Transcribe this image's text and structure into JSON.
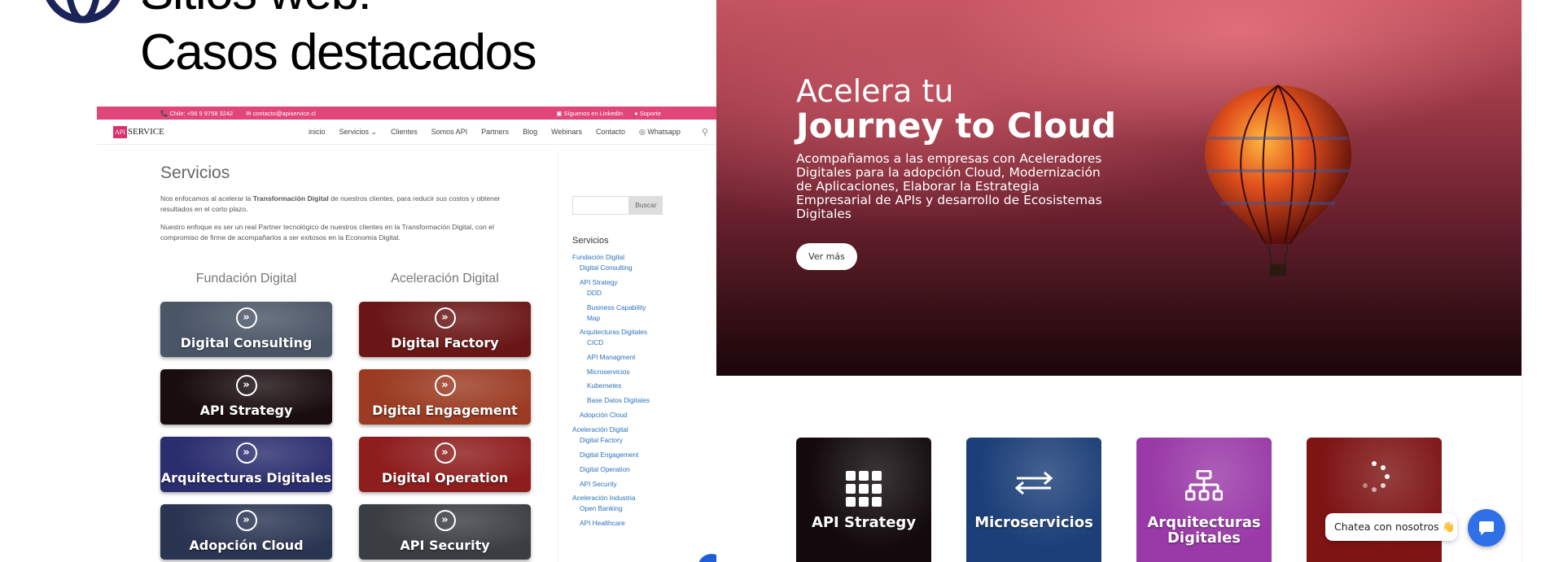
{
  "slide": {
    "title_line1": "Sitios web:",
    "title_line2": "Casos destacados"
  },
  "left_site": {
    "topbar": {
      "phone": "Chile: +56 9 9758 3242",
      "email": "contacto@apiservice.cl",
      "linkedin": "Síguenos en LinkedIn",
      "support": "Soporte"
    },
    "logo": {
      "part1": "API",
      "part2": "SERVICE"
    },
    "nav": [
      "inicio",
      "Servicios",
      "Clientes",
      "Somos API",
      "Partners",
      "Blog",
      "Webinars",
      "Contacto",
      "Whatsapp"
    ],
    "page_title": "Servicios",
    "intro_p1_before": "Nos enfocamos al acelerar la ",
    "intro_p1_bold": "Transformación Digital",
    "intro_p1_after": " de nuestros clientes, para reducir sus costos y obtener resultados en el corto plazo.",
    "intro_p2": "Nuestro enfoque es ser un real Partner tecnológico de nuestros clientes en la Transformación Digital, con el compromiso de firme de acompañarlos a ser exitosos en la Economía Digital.",
    "column_a": "Fundación Digital",
    "column_b": "Aceleración Digital",
    "cards": [
      {
        "label": "Digital Consulting",
        "bg": "#4a5566"
      },
      {
        "label": "Digital Factory",
        "bg": "#6b1616"
      },
      {
        "label": "API Strategy",
        "bg": "#1a0d10"
      },
      {
        "label": "Digital Engagement",
        "bg": "#9b3b22"
      },
      {
        "label": "Arquitecturas Digitales",
        "bg": "#2b2e6e"
      },
      {
        "label": "Digital Operation",
        "bg": "#8e1d1d"
      },
      {
        "label": "Adopción Cloud",
        "bg": "#2a3552"
      },
      {
        "label": "API Security",
        "bg": "#3a3d42"
      }
    ],
    "search_button": "Buscar",
    "sidebar_heading": "Servicios",
    "sidebar_links": [
      "Fundación Digital",
      "Digital Consulting",
      "API Strategy",
      "DDD",
      "Business Capability",
      "Map",
      "Arquitecturas Digitales",
      "CICD",
      "API Managment",
      "Microservicios",
      "Kubernetes",
      "Base Datos Digitales",
      "Adopción Cloud",
      "Aceleración Digital",
      "Digital Factory",
      "Digital Engagement",
      "Digital Operation",
      "API Security",
      "Aceleración Industria",
      "Open Banking",
      "API Healthcare"
    ]
  },
  "right_site": {
    "hero": {
      "line1": "Acelera tu",
      "line2": "Journey to Cloud",
      "subtitle": "Acompañamos a las empresas con Aceleradores Digitales para la adopción Cloud, Modernización de Aplicaciones, Elaborar la Estrategia Empresarial de APIs y desarrollo de Ecosistemas Digitales",
      "button": "Ver más"
    },
    "tiles": [
      {
        "label": "API Strategy",
        "icon": "grid-icon",
        "bg": "#120a0c"
      },
      {
        "label": "Microservicios",
        "icon": "arrows-icon",
        "bg": "#1c3f78"
      },
      {
        "label": "Arquitecturas Digitales",
        "icon": "hierarchy-icon",
        "bg": "#9a3aa8"
      },
      {
        "label": "",
        "icon": "loading-icon",
        "bg": "#7e1414"
      }
    ],
    "chat": {
      "label": "Chatea con nosotros 👋"
    }
  }
}
